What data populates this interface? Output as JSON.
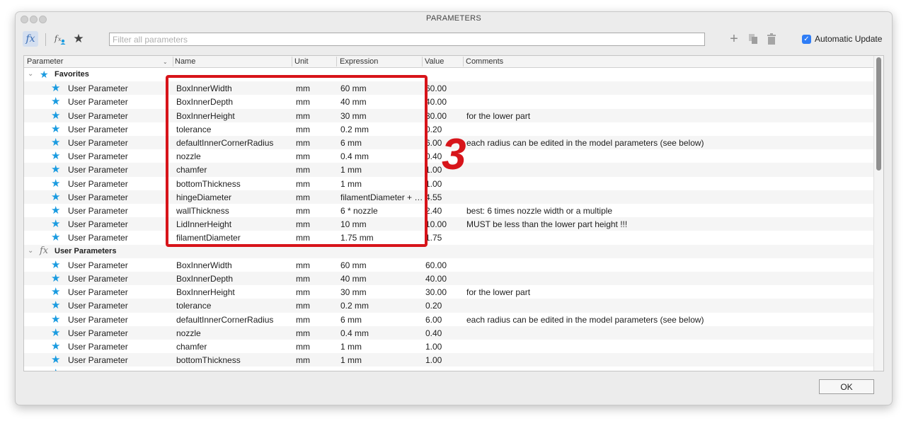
{
  "window": {
    "title": "PARAMETERS"
  },
  "toolbar": {
    "filter_placeholder": "Filter all parameters",
    "auto_update_label": "Automatic Update",
    "auto_update_checked": true
  },
  "columns": [
    "Parameter",
    "Name",
    "Unit",
    "Expression",
    "Value",
    "Comments"
  ],
  "groups": {
    "favorites": "Favorites",
    "user_params": "User Parameters"
  },
  "favorites": [
    [
      "User Parameter",
      "BoxInnerWidth",
      "mm",
      "60 mm",
      "60.00",
      ""
    ],
    [
      "User Parameter",
      "BoxInnerDepth",
      "mm",
      "40 mm",
      "40.00",
      ""
    ],
    [
      "User Parameter",
      "BoxInnerHeight",
      "mm",
      "30 mm",
      "30.00",
      "for the lower part"
    ],
    [
      "User Parameter",
      "tolerance",
      "mm",
      "0.2 mm",
      "0.20",
      ""
    ],
    [
      "User Parameter",
      "defaultInnerCornerRadius",
      "mm",
      "6 mm",
      "6.00",
      "each radius can be edited in the model parameters (see below)"
    ],
    [
      "User Parameter",
      "nozzle",
      "mm",
      "0.4 mm",
      "0.40",
      ""
    ],
    [
      "User Parameter",
      "chamfer",
      "mm",
      "1 mm",
      "1.00",
      ""
    ],
    [
      "User Parameter",
      "bottomThickness",
      "mm",
      "1 mm",
      "1.00",
      ""
    ],
    [
      "User Parameter",
      "hingeDiameter",
      "mm",
      "filamentDiameter + …",
      "4.55",
      ""
    ],
    [
      "User Parameter",
      "wallThickness",
      "mm",
      "6 * nozzle",
      "2.40",
      "best: 6 times nozzle width or a multiple"
    ],
    [
      "User Parameter",
      "LidInnerHeight",
      "mm",
      "10 mm",
      "10.00",
      "MUST be less than the lower part height !!!"
    ],
    [
      "User Parameter",
      "filamentDiameter",
      "mm",
      "1.75 mm",
      "1.75",
      ""
    ]
  ],
  "user_params": [
    [
      "User Parameter",
      "BoxInnerWidth",
      "mm",
      "60 mm",
      "60.00",
      ""
    ],
    [
      "User Parameter",
      "BoxInnerDepth",
      "mm",
      "40 mm",
      "40.00",
      ""
    ],
    [
      "User Parameter",
      "BoxInnerHeight",
      "mm",
      "30 mm",
      "30.00",
      "for the lower part"
    ],
    [
      "User Parameter",
      "tolerance",
      "mm",
      "0.2 mm",
      "0.20",
      ""
    ],
    [
      "User Parameter",
      "defaultInnerCornerRadius",
      "mm",
      "6 mm",
      "6.00",
      "each radius can be edited in the model parameters (see below)"
    ],
    [
      "User Parameter",
      "nozzle",
      "mm",
      "0.4 mm",
      "0.40",
      ""
    ],
    [
      "User Parameter",
      "chamfer",
      "mm",
      "1 mm",
      "1.00",
      ""
    ],
    [
      "User Parameter",
      "bottomThickness",
      "mm",
      "1 mm",
      "1.00",
      ""
    ]
  ],
  "annotation": "3",
  "ok_label": "OK",
  "colors": {
    "accent": "#1a9be0",
    "annotation": "#d7141a",
    "checkbox": "#2f7df6"
  }
}
